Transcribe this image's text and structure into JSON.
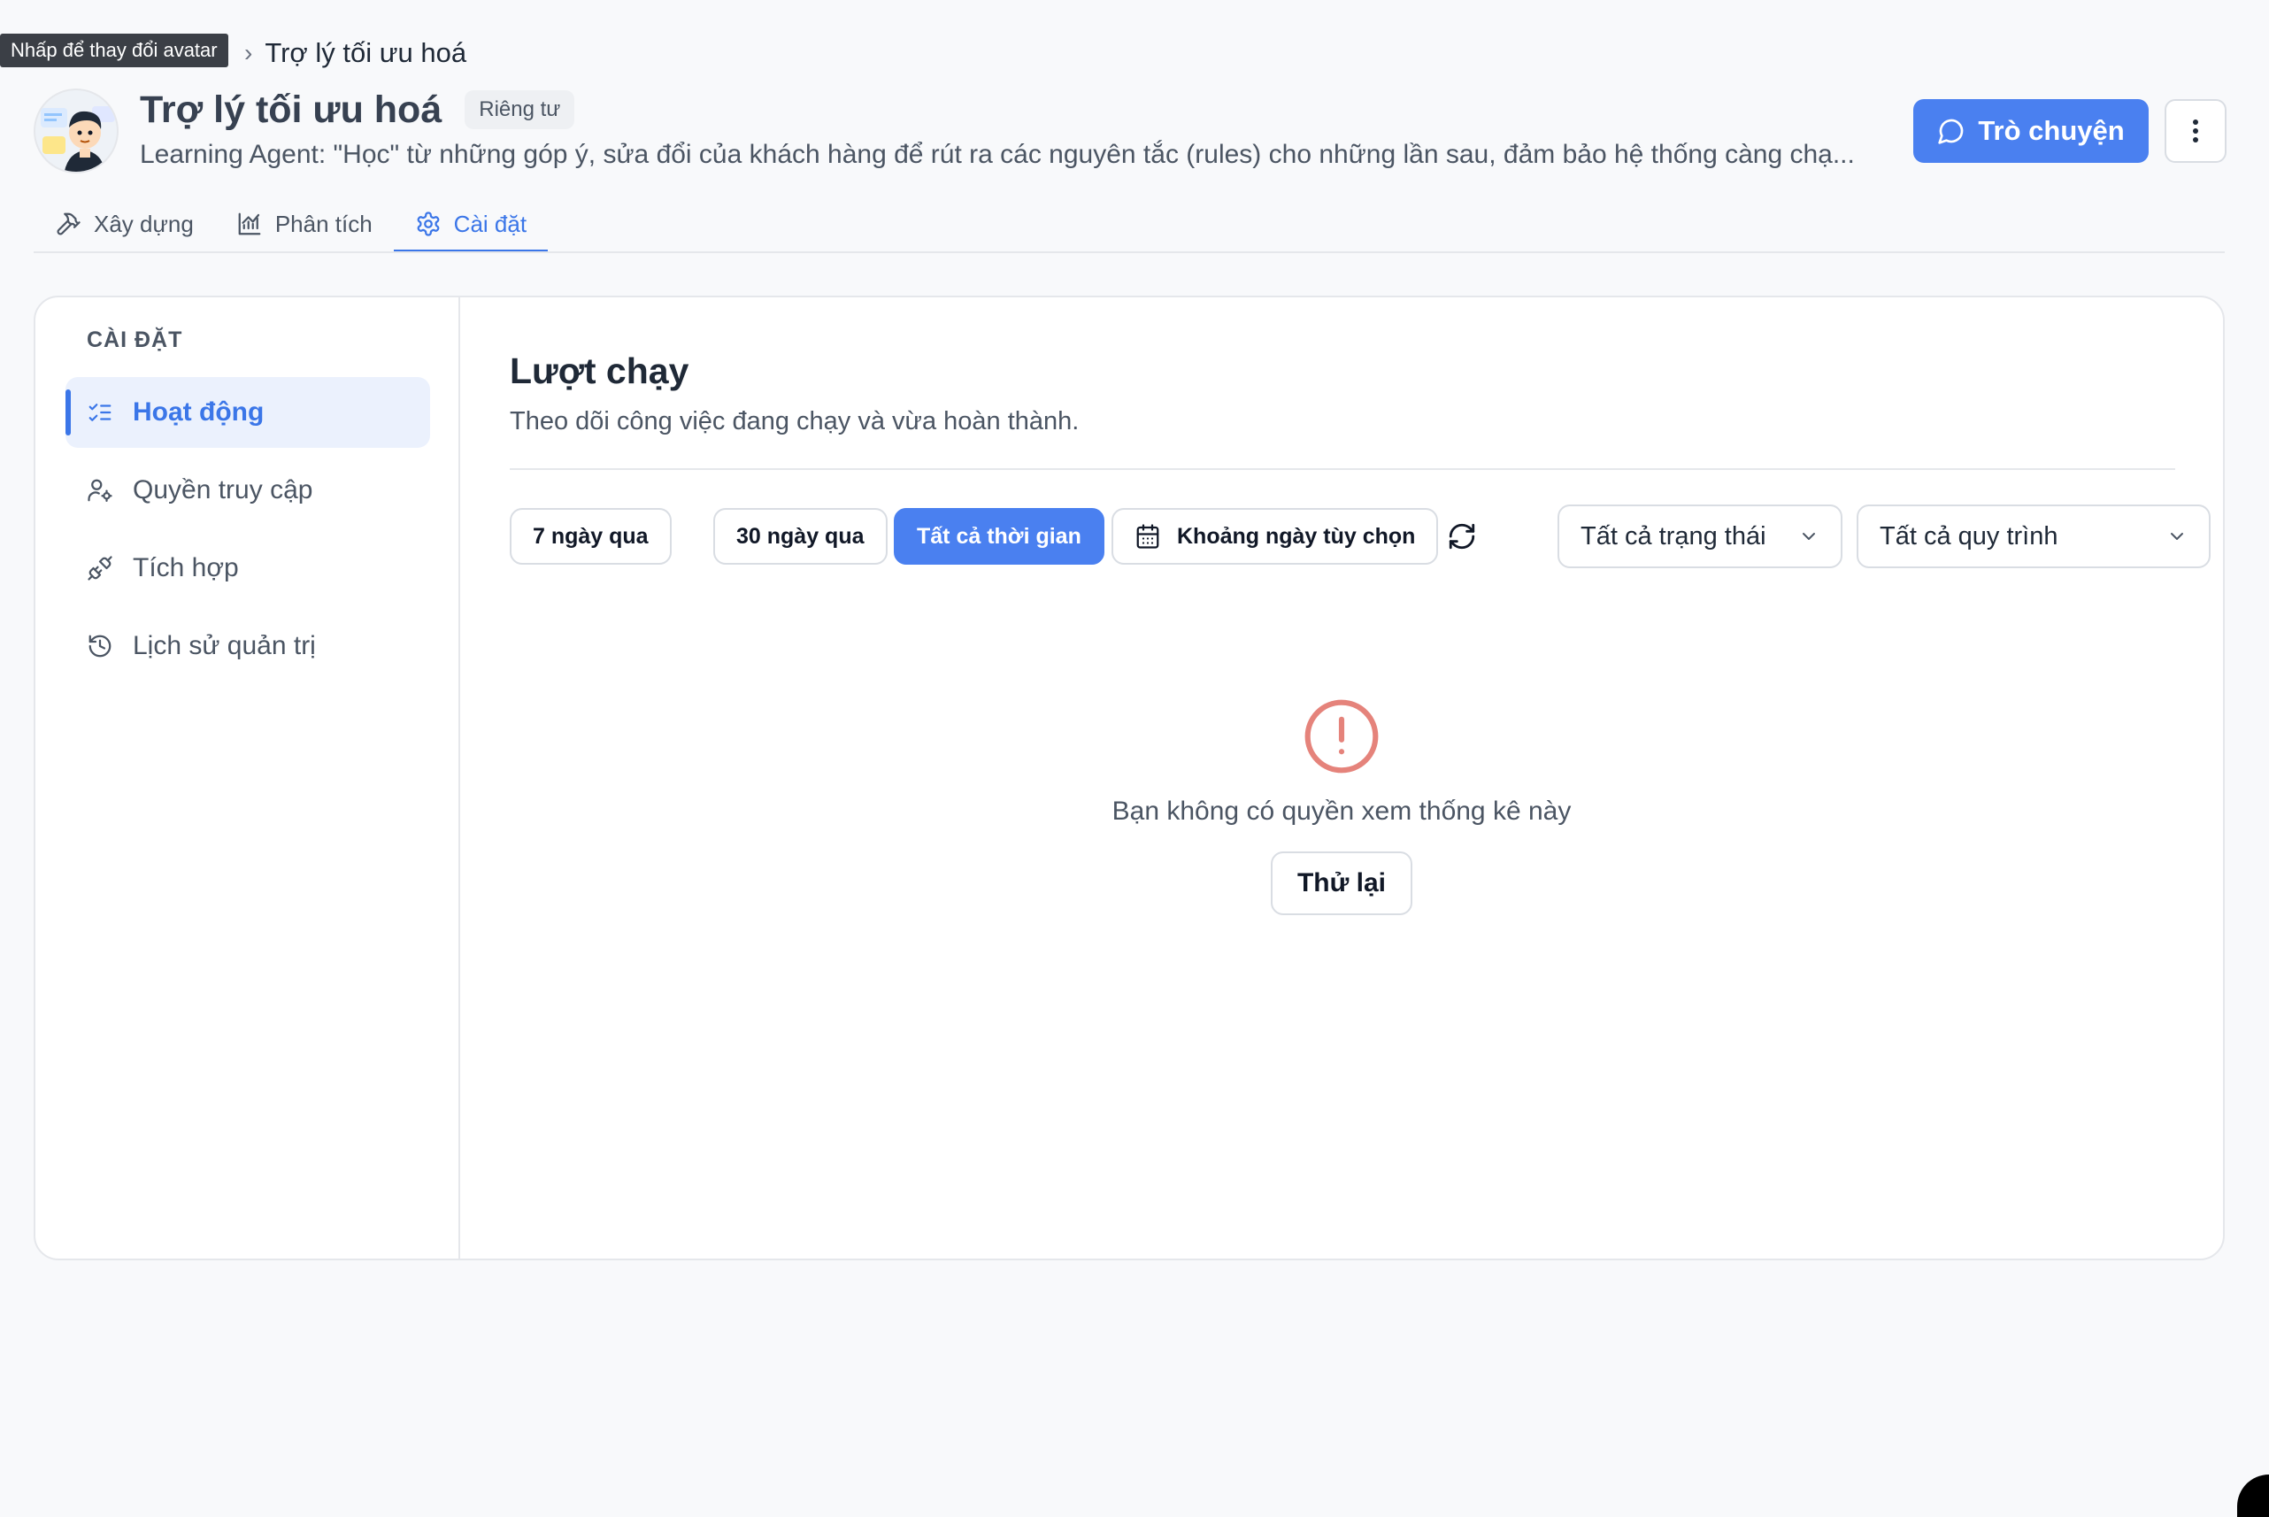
{
  "tooltip": "Nhấp để thay đổi avatar",
  "breadcrumb": {
    "separator": "›",
    "current": "Trợ lý tối ưu hoá"
  },
  "header": {
    "title": "Trợ lý tối ưu hoá",
    "badge": "Riêng tư",
    "description": "Learning Agent: \"Học\" từ những góp ý, sửa đổi của khách hàng để rút ra các nguyên tắc (rules) cho những lần sau, đảm bảo hệ thống càng chạ...",
    "chat_label": "Trò chuyện"
  },
  "tabs": [
    {
      "label": "Xây dựng",
      "icon": "hammer-icon"
    },
    {
      "label": "Phân tích",
      "icon": "chart-icon"
    },
    {
      "label": "Cài đặt",
      "icon": "gear-icon"
    }
  ],
  "sidebar": {
    "heading": "CÀI ĐẶT",
    "items": [
      {
        "label": "Hoạt động",
        "icon": "checklist-icon"
      },
      {
        "label": "Quyền truy cập",
        "icon": "user-gear-icon"
      },
      {
        "label": "Tích hợp",
        "icon": "plug-icon"
      },
      {
        "label": "Lịch sử quản trị",
        "icon": "history-icon"
      }
    ]
  },
  "main": {
    "title": "Lượt chạy",
    "subtitle": "Theo dõi công việc đang chạy và vừa hoàn thành.",
    "filters": {
      "last7": "7 ngày qua",
      "last30": "30 ngày qua",
      "all_time": "Tất cả thời gian",
      "custom_range": "Khoảng ngày tùy chọn",
      "status_select": "Tất cả trạng thái",
      "workflow_select": "Tất cả quy trình"
    },
    "empty": {
      "message": "Bạn không có quyền xem thống kê này",
      "retry_label": "Thử lại"
    }
  },
  "colors": {
    "accent": "#4a80f0",
    "error": "#e5837b"
  }
}
